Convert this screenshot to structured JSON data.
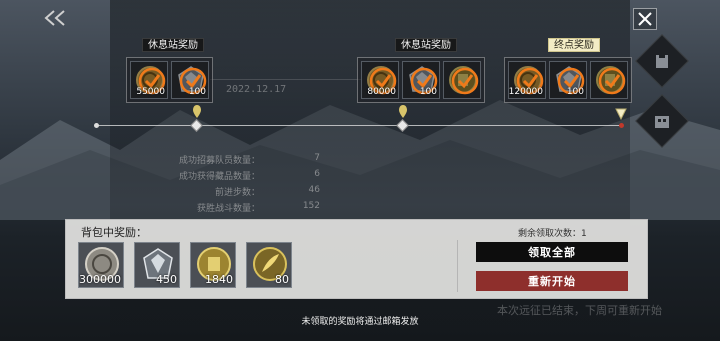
{
  "stations": [
    {
      "label": "休息站奖励",
      "rewards": [
        {
          "icon": "coin-icon",
          "amount": "55000",
          "claimed": true
        },
        {
          "icon": "crystal-icon",
          "amount": "100",
          "claimed": true
        }
      ]
    },
    {
      "label": "休息站奖励",
      "rewards": [
        {
          "icon": "coin-icon",
          "amount": "80000",
          "claimed": true
        },
        {
          "icon": "crystal-icon",
          "amount": "100",
          "claimed": true
        },
        {
          "icon": "medal-icon",
          "amount": "",
          "claimed": true
        }
      ]
    },
    {
      "label": "终点奖励",
      "rewards": [
        {
          "icon": "coin-icon",
          "amount": "120000",
          "claimed": true
        },
        {
          "icon": "crystal-icon",
          "amount": "100",
          "claimed": true
        },
        {
          "icon": "medal-icon",
          "amount": "",
          "claimed": true
        }
      ]
    }
  ],
  "ghost_date": "2022.12.17",
  "stats": [
    {
      "label": "成功招募队员数量：",
      "value": "7"
    },
    {
      "label": "成功获得藏品数量：",
      "value": "6"
    },
    {
      "label": "前进步数：",
      "value": "46"
    },
    {
      "label": "获胜战斗数量：",
      "value": "152"
    }
  ],
  "bag": {
    "title": "背包中奖励：",
    "items": [
      {
        "icon": "coin-icon",
        "amount": "300000"
      },
      {
        "icon": "crystal-icon",
        "amount": "450"
      },
      {
        "icon": "medal-icon",
        "amount": "1840"
      },
      {
        "icon": "feather-icon",
        "amount": "80"
      }
    ],
    "remaining_label": "剩余领取次数：1",
    "claim_all": "领取全部",
    "restart": "重新开始"
  },
  "footer_note": "未领取的奖励将通过邮箱发放",
  "ghost_bottom": "本次远征已结束，下周可重新开始",
  "colors": {
    "accent_orange": "#f07a1a",
    "restart_red": "#8e2f2c",
    "final_label_bg": "#f3ecc5"
  }
}
